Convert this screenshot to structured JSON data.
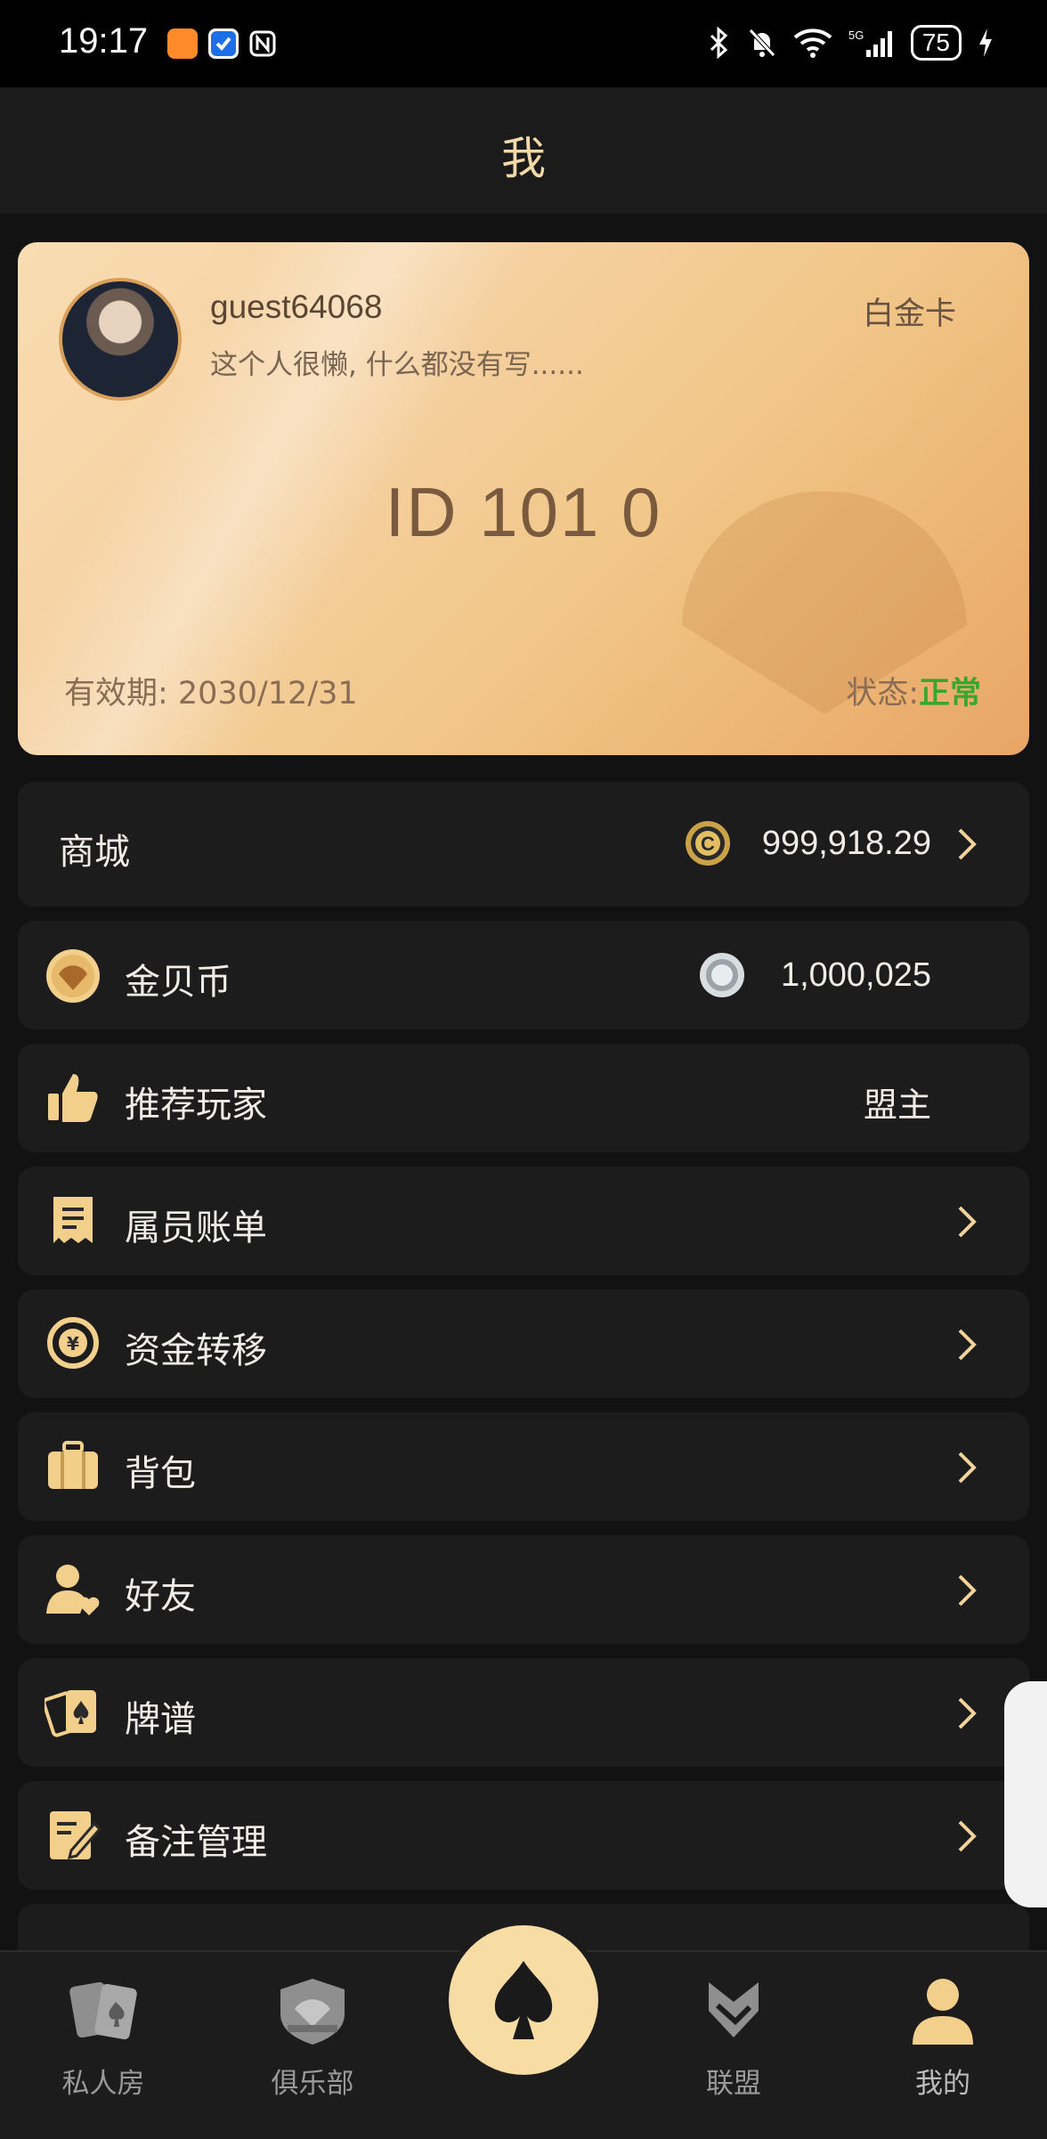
{
  "status_bar": {
    "time": "19:17",
    "battery": "75"
  },
  "header": {
    "title": "我"
  },
  "card": {
    "username": "guest64068",
    "bio": "这个人很懒, 什么都没有写......",
    "tier": "白金卡",
    "id": "ID  101 0",
    "expiry": "有效期: 2030/12/31",
    "status_label": "状态:",
    "status_value": "正常"
  },
  "menu": {
    "mall": {
      "label": "商城",
      "value": "999,918.29"
    },
    "coins": {
      "label": "金贝币",
      "value": "1,000,025"
    },
    "recommend": {
      "label": "推荐玩家",
      "value": "盟主"
    },
    "bill": {
      "label": "属员账单"
    },
    "transfer": {
      "label": "资金转移"
    },
    "bag": {
      "label": "背包"
    },
    "friends": {
      "label": "好友"
    },
    "hands": {
      "label": "牌谱"
    },
    "notes": {
      "label": "备注管理"
    }
  },
  "tabs": {
    "private": "私人房",
    "club": "俱乐部",
    "alliance": "联盟",
    "mine": "我的"
  },
  "colors": {
    "accent": "#f7dca3",
    "status_ok": "#3aa62c",
    "background": "#121212"
  }
}
